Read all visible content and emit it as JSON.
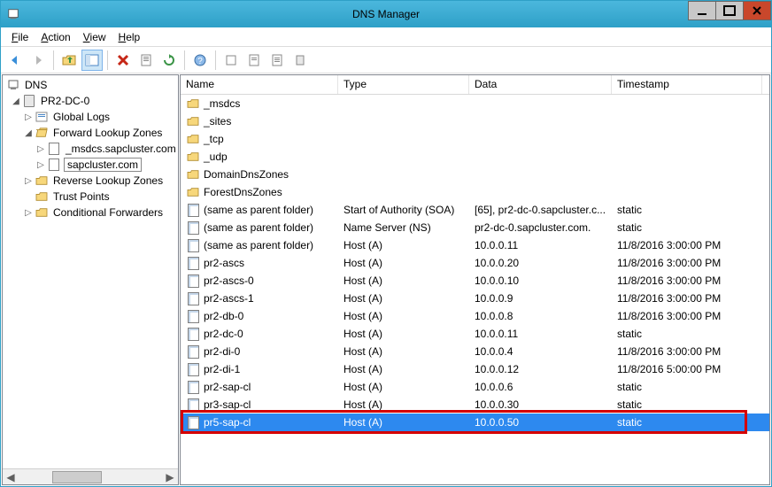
{
  "window": {
    "title": "DNS Manager"
  },
  "menu": {
    "file": "File",
    "action": "Action",
    "view": "View",
    "help": "Help"
  },
  "tree": {
    "root": "DNS",
    "server": "PR2-DC-0",
    "globalLogs": "Global Logs",
    "fwdZones": "Forward Lookup Zones",
    "msdcs": "_msdcs.sapcluster.com",
    "zone": "sapcluster.com",
    "revZones": "Reverse Lookup Zones",
    "trustPoints": "Trust Points",
    "condFwd": "Conditional Forwarders"
  },
  "columns": {
    "name": "Name",
    "type": "Type",
    "data": "Data",
    "ts": "Timestamp"
  },
  "folderRows": [
    {
      "name": "_msdcs"
    },
    {
      "name": "_sites"
    },
    {
      "name": "_tcp"
    },
    {
      "name": "_udp"
    },
    {
      "name": "DomainDnsZones"
    },
    {
      "name": "ForestDnsZones"
    }
  ],
  "records": [
    {
      "name": "(same as parent folder)",
      "type": "Start of Authority (SOA)",
      "data": "[65], pr2-dc-0.sapcluster.c...",
      "ts": "static"
    },
    {
      "name": "(same as parent folder)",
      "type": "Name Server (NS)",
      "data": "pr2-dc-0.sapcluster.com.",
      "ts": "static"
    },
    {
      "name": "(same as parent folder)",
      "type": "Host (A)",
      "data": "10.0.0.11",
      "ts": "11/8/2016 3:00:00 PM"
    },
    {
      "name": "pr2-ascs",
      "type": "Host (A)",
      "data": "10.0.0.20",
      "ts": "11/8/2016 3:00:00 PM"
    },
    {
      "name": "pr2-ascs-0",
      "type": "Host (A)",
      "data": "10.0.0.10",
      "ts": "11/8/2016 3:00:00 PM"
    },
    {
      "name": "pr2-ascs-1",
      "type": "Host (A)",
      "data": "10.0.0.9",
      "ts": "11/8/2016 3:00:00 PM"
    },
    {
      "name": "pr2-db-0",
      "type": "Host (A)",
      "data": "10.0.0.8",
      "ts": "11/8/2016 3:00:00 PM"
    },
    {
      "name": "pr2-dc-0",
      "type": "Host (A)",
      "data": "10.0.0.11",
      "ts": "static"
    },
    {
      "name": "pr2-di-0",
      "type": "Host (A)",
      "data": "10.0.0.4",
      "ts": "11/8/2016 3:00:00 PM"
    },
    {
      "name": "pr2-di-1",
      "type": "Host (A)",
      "data": "10.0.0.12",
      "ts": "11/8/2016 5:00:00 PM"
    },
    {
      "name": "pr2-sap-cl",
      "type": "Host (A)",
      "data": "10.0.0.6",
      "ts": "static"
    },
    {
      "name": "pr3-sap-cl",
      "type": "Host (A)",
      "data": "10.0.0.30",
      "ts": "static"
    },
    {
      "name": "pr5-sap-cl",
      "type": "Host (A)",
      "data": "10.0.0.50",
      "ts": "static",
      "selected": true,
      "highlight": true
    }
  ]
}
